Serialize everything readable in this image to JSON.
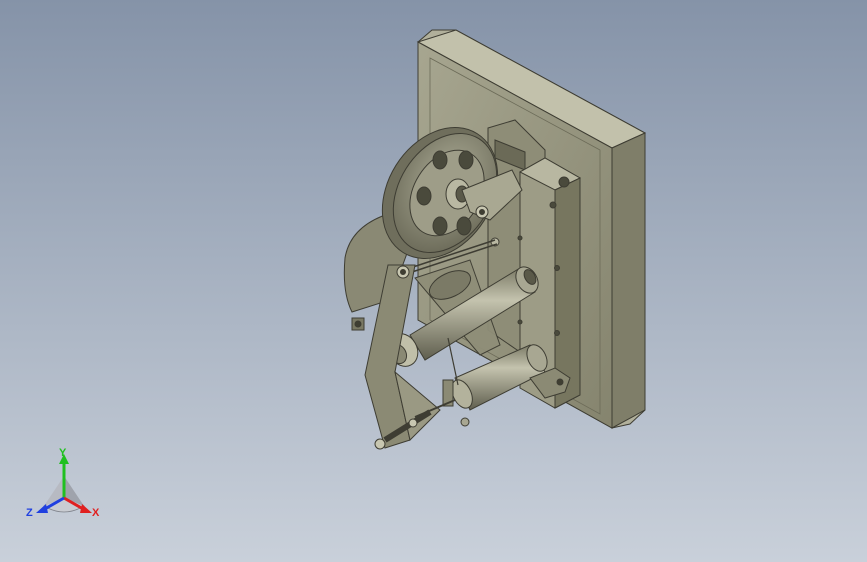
{
  "view": {
    "background_top": "#8593a8",
    "background_bottom": "#c9d0da",
    "model_color": "#8f8e78",
    "model_shadow": "#5f5e4e",
    "model_light": "#b4b39c"
  },
  "triad": {
    "x_label": "X",
    "y_label": "Y",
    "z_label": "Z",
    "x_color": "#e02020",
    "y_color": "#20c020",
    "z_color": "#2040e0"
  }
}
